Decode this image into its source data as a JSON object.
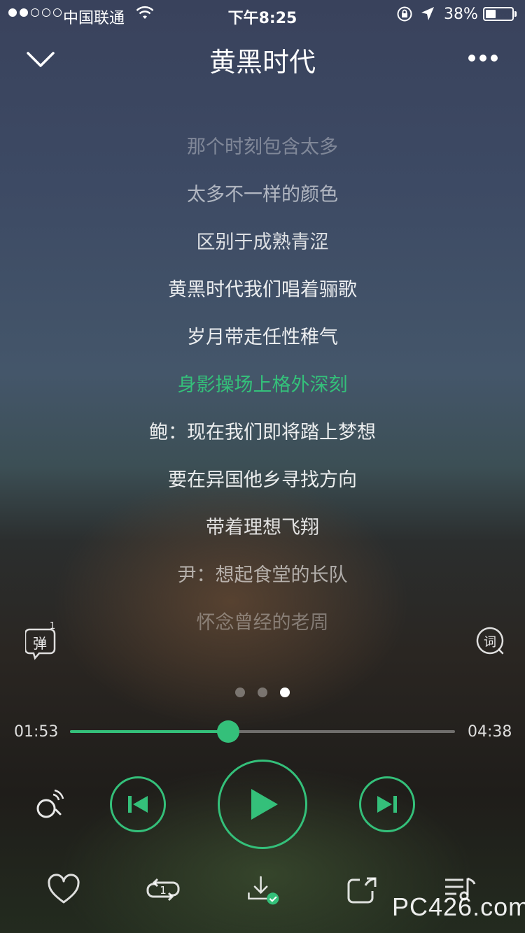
{
  "status_bar": {
    "carrier": "中国联通",
    "time": "下午8:25",
    "battery_percent": "38%",
    "battery_level": 0.38,
    "signal_dots_filled": 2,
    "signal_dots_total": 5
  },
  "header": {
    "title": "黄黑时代",
    "back_icon": "chevron-down-icon",
    "more_icon": "more-dots-icon"
  },
  "lyrics": {
    "lines": [
      "那个时刻包含太多",
      "太多不一样的颜色",
      "区别于成熟青涩",
      "黄黑时代我们唱着骊歌",
      "岁月带走任性稚气",
      "身影操场上格外深刻",
      "鲍：现在我们即将踏上梦想",
      "要在异国他乡寻找方向",
      "带着理想飞翔",
      "尹：想起食堂的长队",
      "怀念曾经的老周"
    ],
    "current_index": 5
  },
  "side_buttons": {
    "danmu_label": "弹",
    "danmu_count": "1",
    "lyric_label": "词"
  },
  "pager": {
    "count": 3,
    "active": 2
  },
  "progress": {
    "current": "01:53",
    "total": "04:38",
    "fraction": 0.41
  },
  "controls": {
    "radio_icon": "radio-icon",
    "prev_icon": "skip-previous-icon",
    "play_icon": "play-icon",
    "next_icon": "skip-next-icon"
  },
  "bottom_bar": {
    "like_icon": "heart-icon",
    "repeat_icon": "repeat-one-icon",
    "repeat_badge": "1",
    "download_icon": "download-done-icon",
    "share_icon": "share-icon",
    "playlist_icon": "playlist-icon"
  },
  "watermark": "PC426.com",
  "colors": {
    "accent": "#34c07a"
  }
}
